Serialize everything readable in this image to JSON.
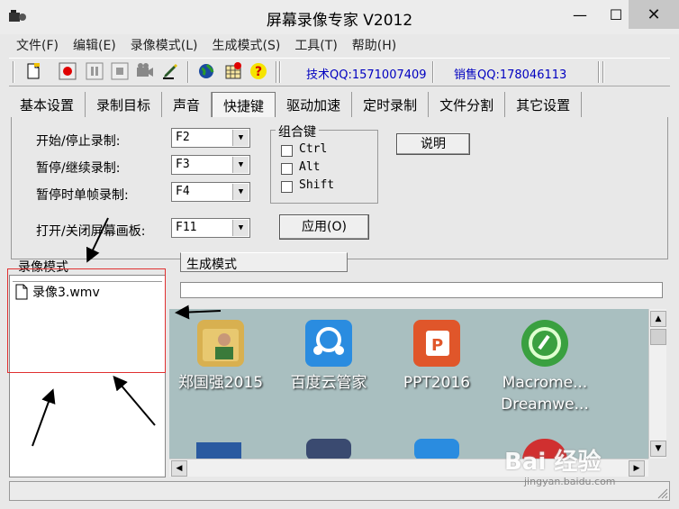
{
  "window": {
    "title": "屏幕录像专家 V2012",
    "min": "—",
    "max": "☐",
    "close": "✕"
  },
  "menu": [
    "文件(F)",
    "编辑(E)",
    "录像模式(L)",
    "生成模式(S)",
    "工具(T)",
    "帮助(H)"
  ],
  "toolbar": {
    "tech_qq": "技术QQ:1571007409",
    "sales_qq": "销售QQ:178046113",
    "icons": [
      "new-file-icon",
      "record-icon",
      "pause-icon",
      "stop-icon",
      "camera-icon",
      "pen-icon",
      "globe-icon",
      "grid-star-icon",
      "help-icon"
    ]
  },
  "tabs": [
    "基本设置",
    "录制目标",
    "声音",
    "快捷键",
    "驱动加速",
    "定时录制",
    "文件分割",
    "其它设置"
  ],
  "active_tab": "快捷键",
  "hotkeys": [
    {
      "label": "开始/停止录制:",
      "value": "F2"
    },
    {
      "label": "暂停/继续录制:",
      "value": "F3"
    },
    {
      "label": "暂停时单帧录制:",
      "value": "F4"
    },
    {
      "label": "打开/关闭屏幕画板:",
      "value": "F11"
    }
  ],
  "combo_group": {
    "title": "组合键",
    "options": [
      "Ctrl",
      "Alt",
      "Shift"
    ]
  },
  "buttons": {
    "explain": "说明",
    "apply": "应用(O)"
  },
  "record_mode": {
    "label": "录像模式",
    "files": [
      "录像3.wmv"
    ]
  },
  "gen_mode": {
    "label": "生成模式"
  },
  "desktop_icons": [
    {
      "caption": "郑国强2015",
      "icon": "user-folder-icon",
      "color": "#d8b050"
    },
    {
      "caption": "百度云管家",
      "icon": "baidu-cloud-icon",
      "color": "#2a8ce0"
    },
    {
      "caption": "PPT2016",
      "icon": "powerpoint-icon",
      "color": "#e0562a"
    },
    {
      "caption": "Macrome...\nDreamwe...",
      "icon": "dreamweaver-icon",
      "color": "#3aa040"
    }
  ],
  "watermark": {
    "main": "Bai 经验",
    "sub": "jingyan.baidu.com"
  },
  "colors": {
    "link": "#0000c0",
    "annotation": "#e03030",
    "preview_bg": "#a9bfc0"
  }
}
